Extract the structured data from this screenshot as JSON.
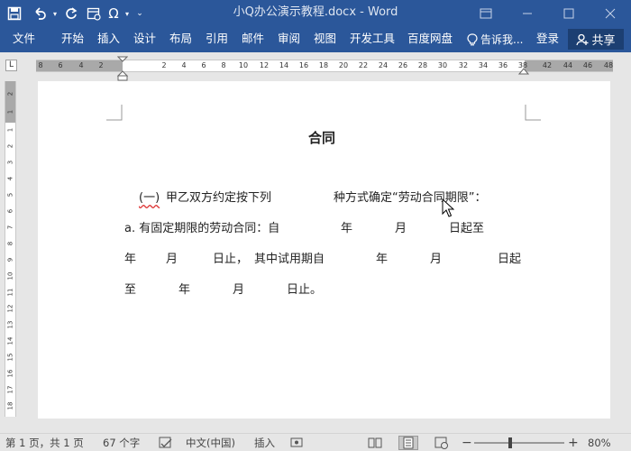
{
  "window": {
    "title": "小Q办公演示教程.docx - Word"
  },
  "quick_access": {
    "save_icon": "save-icon",
    "undo_icon": "undo-icon",
    "redo_icon": "redo-icon",
    "symbol_label": "Ω"
  },
  "ribbon": {
    "tabs": [
      {
        "label": "文件"
      },
      {
        "label": "开始"
      },
      {
        "label": "插入"
      },
      {
        "label": "设计"
      },
      {
        "label": "布局"
      },
      {
        "label": "引用"
      },
      {
        "label": "邮件"
      },
      {
        "label": "审阅"
      },
      {
        "label": "视图"
      },
      {
        "label": "开发工具"
      },
      {
        "label": "百度网盘"
      }
    ],
    "tell_me": "告诉我...",
    "login": "登录",
    "share": "共享"
  },
  "ruler": {
    "horizontal_ticks": [
      "8",
      "6",
      "4",
      "2",
      "2",
      "4",
      "6",
      "8",
      "10",
      "12",
      "14",
      "16",
      "18",
      "20",
      "22",
      "24",
      "26",
      "28",
      "30",
      "32",
      "34",
      "36",
      "38",
      "42",
      "44",
      "46",
      "48"
    ],
    "vertical_ticks": [
      "2",
      "1",
      "1",
      "2",
      "3",
      "4",
      "5",
      "6",
      "7",
      "8",
      "9",
      "10",
      "11",
      "12",
      "13",
      "14",
      "15",
      "16",
      "17",
      "18"
    ],
    "corner": "L"
  },
  "document": {
    "title": "合同",
    "clause_prefix": "(一)",
    "clause_part1": "甲乙双方约定按下列",
    "clause_part2": "种方式确定“劳动合同期限”：",
    "line_a_label": "a. 有固定期限的劳动合同：自",
    "nian": "年",
    "yue": "月",
    "ri_qi_zhi": "日起至",
    "ri_zhi": "日止，",
    "shiyong": "其中试用期自",
    "ri_qi": "日起",
    "zhi": "至",
    "ri_zhi_end": "日止。"
  },
  "status": {
    "page": "第 1 页，共 1 页",
    "words": "67 个字",
    "language": "中文(中国)",
    "mode": "插入",
    "zoom": "80%",
    "zoom_level": 0.8
  }
}
